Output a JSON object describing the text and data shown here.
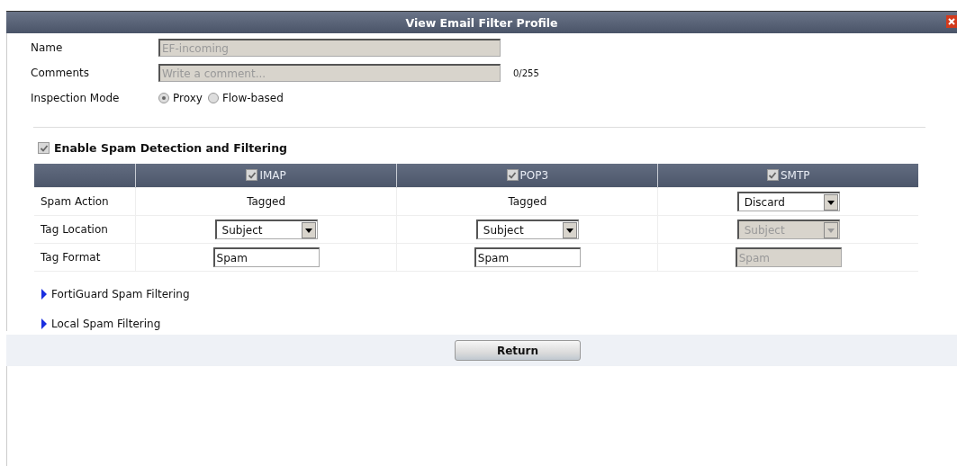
{
  "window": {
    "title": "View Email Filter Profile"
  },
  "form": {
    "name": {
      "label": "Name",
      "value": "EF-incoming",
      "disabled": true
    },
    "comments": {
      "label": "Comments",
      "placeholder": "Write a comment...",
      "counter": "0/255",
      "disabled": true
    },
    "inspection_mode": {
      "label": "Inspection Mode",
      "disabled": true,
      "options": [
        {
          "label": "Proxy",
          "selected": true
        },
        {
          "label": "Flow-based",
          "selected": false
        }
      ]
    }
  },
  "spam_detection": {
    "label": "Enable Spam Detection and Filtering",
    "checked": true,
    "disabled": true
  },
  "table": {
    "columns": [
      {
        "label": "IMAP",
        "checked": true,
        "disabled": true
      },
      {
        "label": "POP3",
        "checked": true,
        "disabled": true
      },
      {
        "label": "SMTP",
        "checked": true,
        "disabled": true
      }
    ],
    "rows": [
      {
        "label": "Spam Action",
        "cells": [
          {
            "kind": "text",
            "value": "Tagged"
          },
          {
            "kind": "text",
            "value": "Tagged"
          },
          {
            "kind": "select",
            "value": "Discard",
            "disabled": false
          }
        ]
      },
      {
        "label": "Tag Location",
        "cells": [
          {
            "kind": "select",
            "value": "Subject",
            "disabled": false
          },
          {
            "kind": "select",
            "value": "Subject",
            "disabled": false
          },
          {
            "kind": "select",
            "value": "Subject",
            "disabled": true
          }
        ]
      },
      {
        "label": "Tag Format",
        "cells": [
          {
            "kind": "input",
            "value": "Spam",
            "disabled": false
          },
          {
            "kind": "input",
            "value": "Spam",
            "disabled": false
          },
          {
            "kind": "input",
            "value": "Spam",
            "disabled": true
          }
        ]
      }
    ]
  },
  "sections": [
    {
      "label": "FortiGuard Spam Filtering",
      "expanded": false
    },
    {
      "label": "Local Spam Filtering",
      "expanded": false
    }
  ],
  "buttons": [
    "Return"
  ]
}
